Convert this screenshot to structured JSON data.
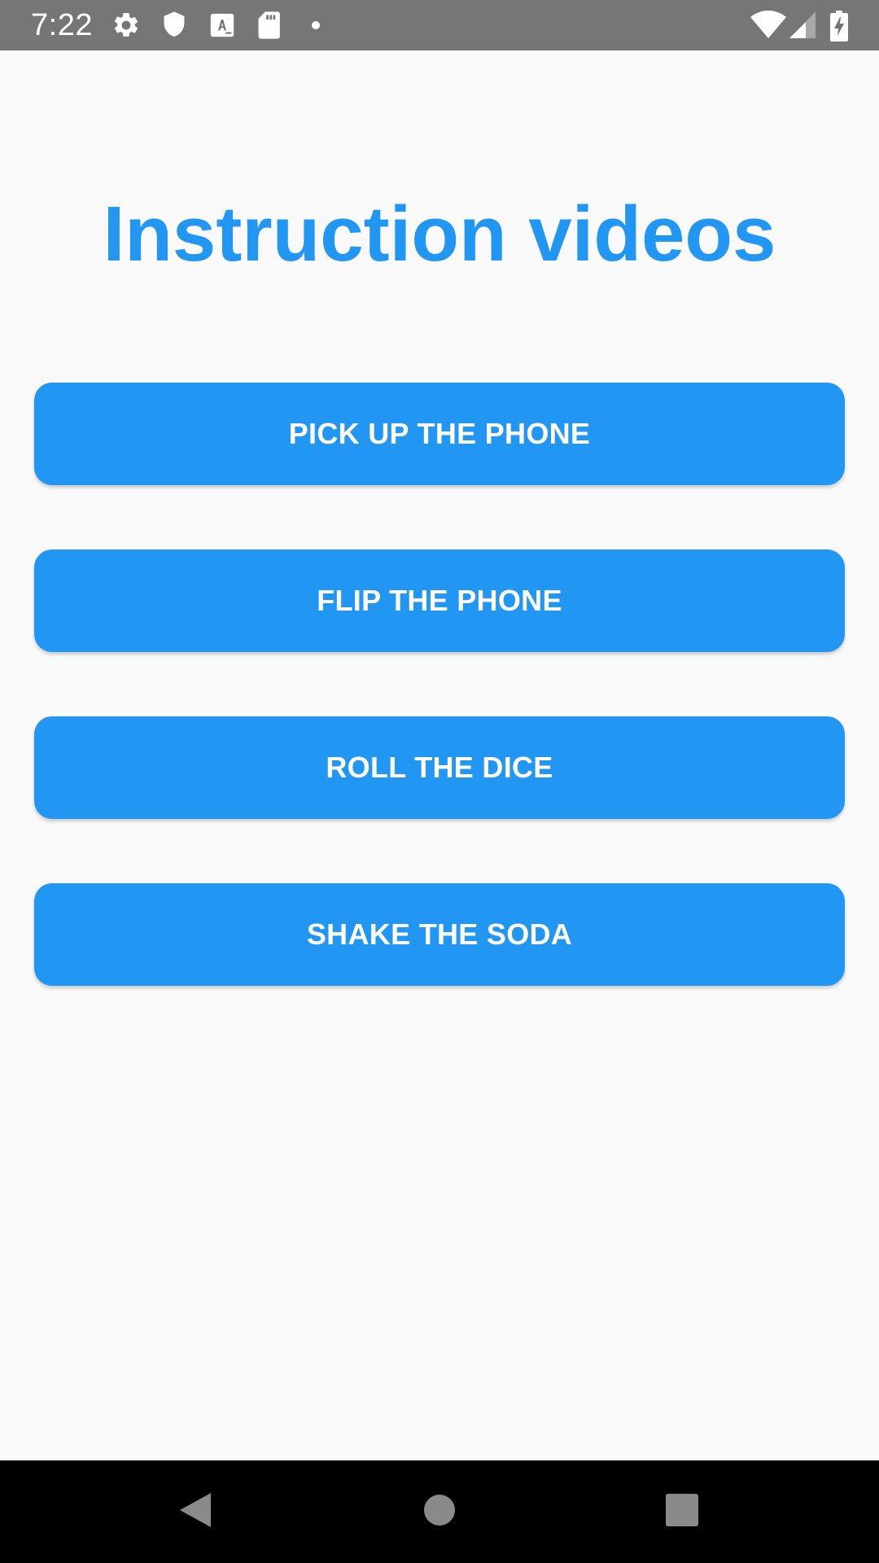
{
  "status_bar": {
    "time": "7:22",
    "left_icons": [
      "gear-icon",
      "shield-icon",
      "font-download-icon",
      "sd-card-icon",
      "dot-icon"
    ],
    "right_icons": [
      "wifi-icon",
      "cell-signal-icon",
      "battery-charging-icon"
    ]
  },
  "main": {
    "title": "Instruction videos",
    "buttons": [
      {
        "label": "PICK UP THE PHONE"
      },
      {
        "label": "FLIP THE PHONE"
      },
      {
        "label": "ROLL THE DICE"
      },
      {
        "label": "SHAKE THE SODA"
      }
    ]
  },
  "nav_bar": {
    "icons": [
      "back-icon",
      "home-icon",
      "recents-icon"
    ]
  },
  "colors": {
    "accent": "#2196f3",
    "background": "#f9f9f9",
    "status_bar": "#767676",
    "nav_bar": "#000000"
  }
}
